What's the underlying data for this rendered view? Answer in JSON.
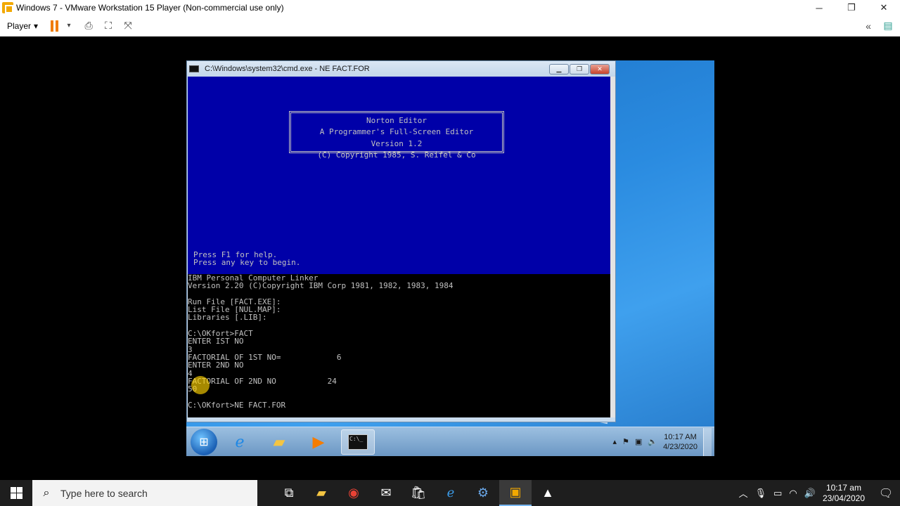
{
  "vm_window": {
    "title": "Windows 7 - VMware Workstation 15 Player (Non-commercial use only)",
    "controls": {
      "minimize": "─",
      "restore": "❐",
      "close": "✕"
    },
    "toolbar": {
      "player_label": "Player",
      "collapse_icon": "«"
    }
  },
  "cmd_window": {
    "title": "C:\\Windows\\system32\\cmd.exe - NE  FACT.FOR"
  },
  "norton_editor": {
    "line1": "Norton Editor",
    "line2": "A Programmer's Full-Screen Editor",
    "line3": "Version 1.2",
    "line4": "(C) Copyright 1985, S. Reifel & Co",
    "help1": "Press F1 for help.",
    "help2": "Press any key to begin."
  },
  "dos_output": [
    "IBM Personal Computer Linker",
    "Version 2.20 (C)Copyright IBM Corp 1981, 1982, 1983, 1984",
    "",
    "Run File [FACT.EXE]:",
    "List File [NUL.MAP]:",
    "Libraries [.LIB]:",
    "",
    "C:\\OKfort>FACT",
    "ENTER IST NO",
    "3",
    "FACTORIAL OF 1ST NO=            6",
    "ENTER 2ND NO",
    "4",
    "FACTORIAL OF 2ND NO           24",
    "50",
    "",
    "C:\\OKfort>NE FACT.FOR"
  ],
  "guest_taskbar": {
    "time": "10:17 AM",
    "date": "4/23/2020",
    "cmd_icon_text": "C:\\_"
  },
  "host_taskbar": {
    "search_placeholder": "Type here to search",
    "time": "10:17 am",
    "date": "23/04/2020"
  }
}
